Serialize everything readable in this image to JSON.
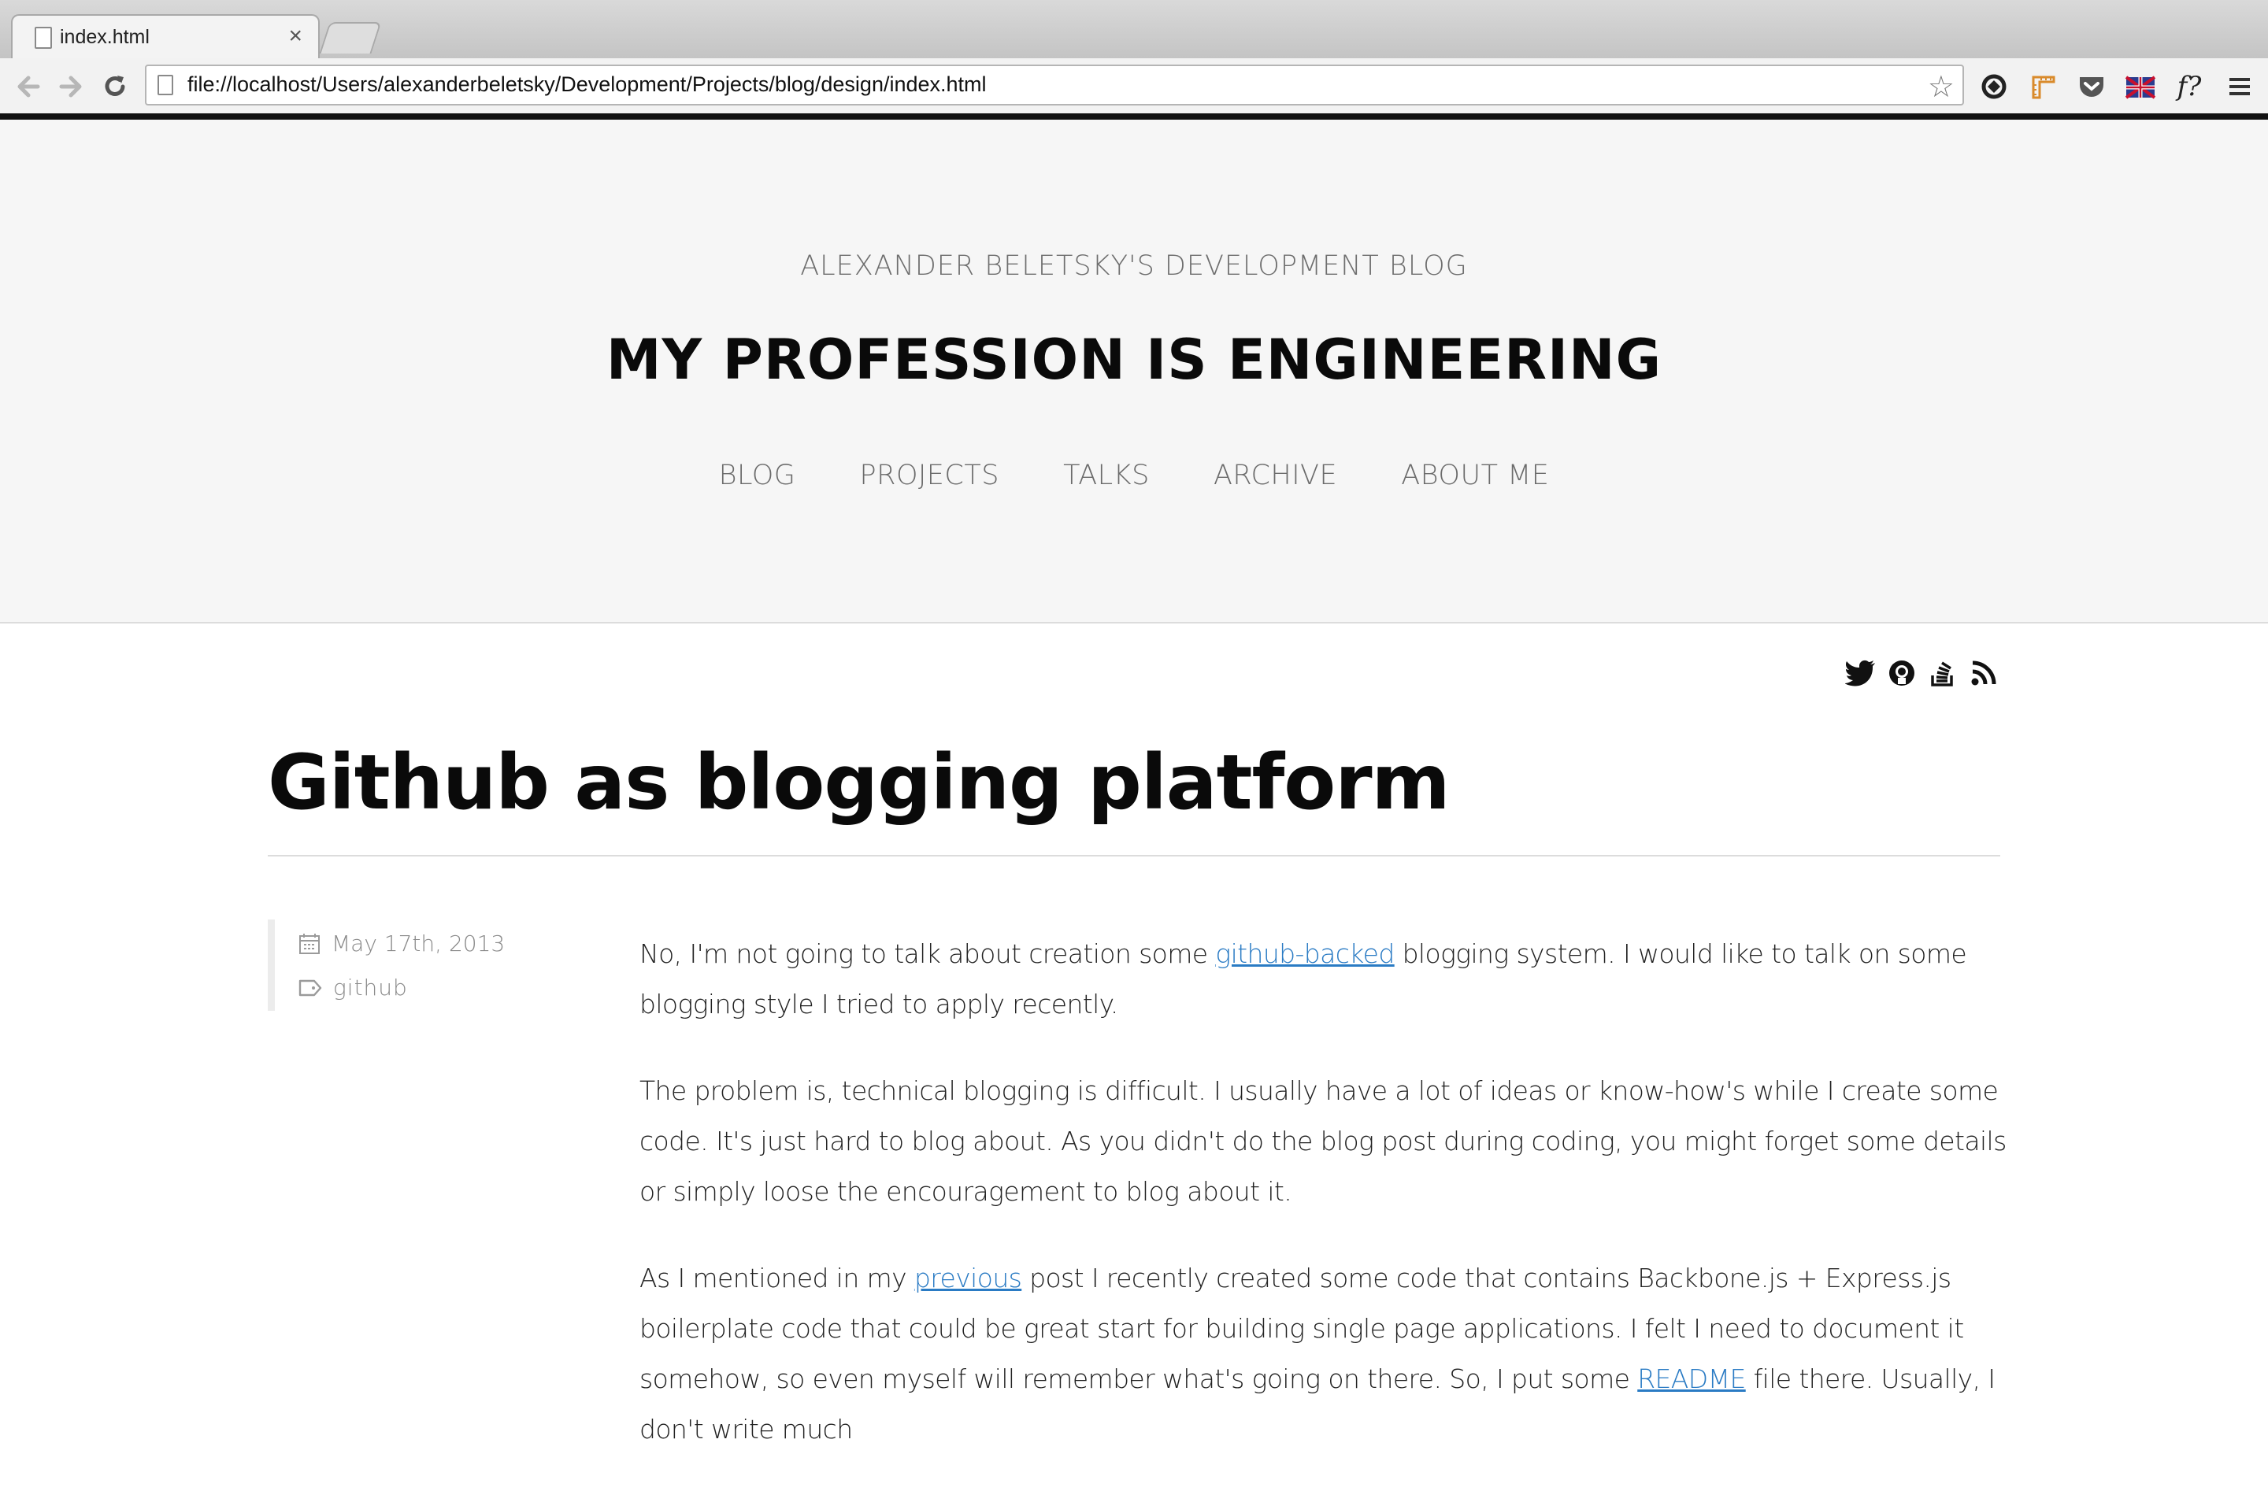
{
  "browser": {
    "tab_title": "index.html",
    "tab_close": "×",
    "url": "file://localhost/Users/alexanderbeletsky/Development/Projects/blog/design/index.html",
    "extensions": [
      "sync-icon",
      "ruler-icon",
      "pocket-icon",
      "flag-icon",
      "fontface-icon",
      "menu-icon"
    ],
    "fontface_label": "f?"
  },
  "header": {
    "subtitle": "ALEXANDER BELETSKY'S DEVELOPMENT BLOG",
    "title": "MY PROFESSION IS ENGINEERING",
    "nav": [
      "BLOG",
      "PROJECTS",
      "TALKS",
      "ARCHIVE",
      "ABOUT ME"
    ]
  },
  "social": [
    "twitter-icon",
    "github-icon",
    "stackoverflow-icon",
    "rss-icon"
  ],
  "post": {
    "title": "Github as blogging platform",
    "date": "May 17th, 2013",
    "tag": "github",
    "p1": {
      "before": "No, I'm not going to talk about creation some ",
      "link": "github-backed",
      "after": " blogging system. I would like to talk on some blogging style I tried to apply recently."
    },
    "p2": "The problem is, technical blogging is difficult. I usually have a lot of ideas or know-how's while I create some code. It's just hard to blog about. As you didn't do the blog post during coding, you might forget some details or simply loose the encouragement to blog about it.",
    "p3": {
      "before": "As I mentioned in my ",
      "link1": "previous",
      "middle": " post I recently created some code that contains Backbone.js + Express.js boilerplate code that could be great start for building single page applications. I felt I need to document it somehow, so even myself will remember what's going on there. So, I put some ",
      "link2": "README",
      "after": " file there. Usually, I don't write much"
    }
  }
}
